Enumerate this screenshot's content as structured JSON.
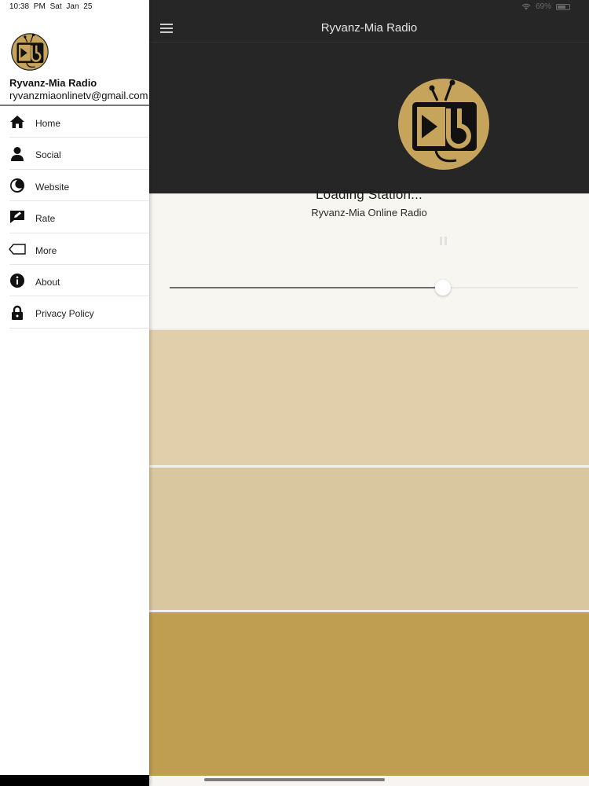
{
  "status_bar": {
    "time": "10:38 PM",
    "date": "Sat Jan 25",
    "battery": "69%"
  },
  "navbar": {
    "title": "Ryvanz-Mia Radio"
  },
  "player": {
    "status_text": "Loading Station...",
    "station_name": "Ryvanz-Mia Online Radio",
    "volume_fraction": 0.67
  },
  "drawer": {
    "app_name": "Ryvanz-Mia Radio",
    "email": "ryvanzmiaonlinetv@gmail.com",
    "items": [
      {
        "label": "Home",
        "icon": "home-icon"
      },
      {
        "label": "Social",
        "icon": "person-icon"
      },
      {
        "label": "Website",
        "icon": "browser-icon"
      },
      {
        "label": "Rate",
        "icon": "rate-icon"
      },
      {
        "label": "More",
        "icon": "tag-icon"
      },
      {
        "label": "About",
        "icon": "info-icon"
      },
      {
        "label": "Privacy Policy",
        "icon": "lock-icon"
      }
    ]
  },
  "colors": {
    "topbar": "#262626",
    "logo_gold": "#c7a45c",
    "panel_1": "#e1ceab",
    "panel_2": "#d9c79f",
    "panel_3": "#bf9e52"
  }
}
